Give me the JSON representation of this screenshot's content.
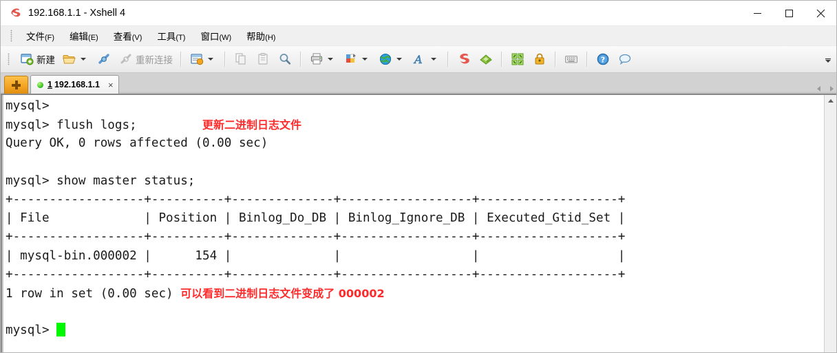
{
  "window": {
    "title": "192.168.1.1 - Xshell 4",
    "app_icon": "xshell-logo-icon",
    "controls": {
      "minimize": "minimize-icon",
      "maximize": "maximize-icon",
      "close": "close-icon"
    }
  },
  "menu": {
    "items": [
      {
        "label": "文件",
        "key": "(F)"
      },
      {
        "label": "编辑",
        "key": "(E)"
      },
      {
        "label": "查看",
        "key": "(V)"
      },
      {
        "label": "工具",
        "key": "(T)"
      },
      {
        "label": "窗口",
        "key": "(W)"
      },
      {
        "label": "帮助",
        "key": "(H)"
      }
    ]
  },
  "toolbar": {
    "new_label": "新建",
    "reconnect_label": "重新连接",
    "overflow": "toolbar-overflow-chevron"
  },
  "tabbar": {
    "new_tab": "new-tab-button",
    "tabs": [
      {
        "number": "1",
        "title": "192.168.1.1",
        "status": "connected",
        "close": "×"
      }
    ]
  },
  "terminal": {
    "prompt": "mysql>",
    "lines": [
      {
        "text": "mysql>"
      },
      {
        "text": "mysql> flush logs;",
        "note": "更新二进制日志文件",
        "note_col": 27
      },
      {
        "text": "Query OK, 0 rows affected (0.00 sec)"
      },
      {
        "text": ""
      },
      {
        "text": "mysql> show master status;"
      },
      {
        "text": "+------------------+----------+--------------+------------------+-------------------+"
      },
      {
        "text": "| File             | Position | Binlog_Do_DB | Binlog_Ignore_DB | Executed_Gtid_Set |"
      },
      {
        "text": "+------------------+----------+--------------+------------------+-------------------+"
      },
      {
        "text": "| mysql-bin.000002 |      154 |              |                  |                   |"
      },
      {
        "text": "+------------------+----------+--------------+------------------+-------------------+"
      },
      {
        "text": "1 row in set (0.00 sec)",
        "note": "可以看到二进制日志文件变成了 000002",
        "note_col": 24
      },
      {
        "text": ""
      },
      {
        "text": "mysql> ",
        "cursor": true
      }
    ]
  },
  "scrollbar": {
    "up_arrow": "scroll-up-arrow"
  },
  "colors": {
    "annotation_red": "#fd2c2c",
    "cursor_green": "#00f900",
    "tab_accent": "#f5a623",
    "terminal_bg": "#ffffff",
    "terminal_fg": "#1b1b1b"
  }
}
